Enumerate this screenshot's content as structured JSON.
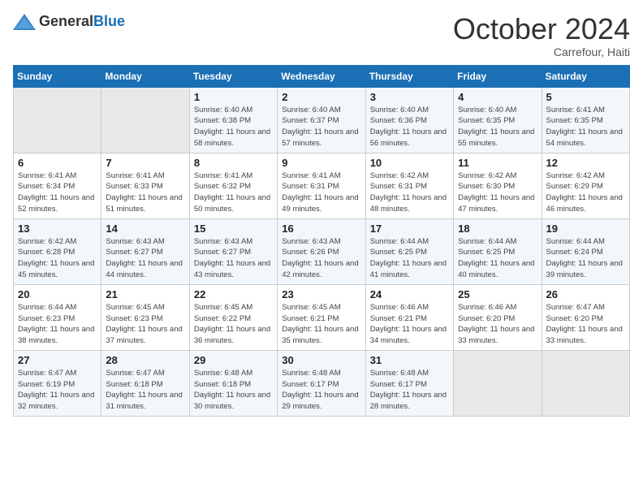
{
  "header": {
    "logo_general": "General",
    "logo_blue": "Blue",
    "title": "October 2024",
    "subtitle": "Carrefour, Haiti"
  },
  "days_of_week": [
    "Sunday",
    "Monday",
    "Tuesday",
    "Wednesday",
    "Thursday",
    "Friday",
    "Saturday"
  ],
  "weeks": [
    [
      {
        "day": "",
        "info": ""
      },
      {
        "day": "",
        "info": ""
      },
      {
        "day": "1",
        "info": "Sunrise: 6:40 AM\nSunset: 6:38 PM\nDaylight: 11 hours and 58 minutes."
      },
      {
        "day": "2",
        "info": "Sunrise: 6:40 AM\nSunset: 6:37 PM\nDaylight: 11 hours and 57 minutes."
      },
      {
        "day": "3",
        "info": "Sunrise: 6:40 AM\nSunset: 6:36 PM\nDaylight: 11 hours and 56 minutes."
      },
      {
        "day": "4",
        "info": "Sunrise: 6:40 AM\nSunset: 6:35 PM\nDaylight: 11 hours and 55 minutes."
      },
      {
        "day": "5",
        "info": "Sunrise: 6:41 AM\nSunset: 6:35 PM\nDaylight: 11 hours and 54 minutes."
      }
    ],
    [
      {
        "day": "6",
        "info": "Sunrise: 6:41 AM\nSunset: 6:34 PM\nDaylight: 11 hours and 52 minutes."
      },
      {
        "day": "7",
        "info": "Sunrise: 6:41 AM\nSunset: 6:33 PM\nDaylight: 11 hours and 51 minutes."
      },
      {
        "day": "8",
        "info": "Sunrise: 6:41 AM\nSunset: 6:32 PM\nDaylight: 11 hours and 50 minutes."
      },
      {
        "day": "9",
        "info": "Sunrise: 6:41 AM\nSunset: 6:31 PM\nDaylight: 11 hours and 49 minutes."
      },
      {
        "day": "10",
        "info": "Sunrise: 6:42 AM\nSunset: 6:31 PM\nDaylight: 11 hours and 48 minutes."
      },
      {
        "day": "11",
        "info": "Sunrise: 6:42 AM\nSunset: 6:30 PM\nDaylight: 11 hours and 47 minutes."
      },
      {
        "day": "12",
        "info": "Sunrise: 6:42 AM\nSunset: 6:29 PM\nDaylight: 11 hours and 46 minutes."
      }
    ],
    [
      {
        "day": "13",
        "info": "Sunrise: 6:42 AM\nSunset: 6:28 PM\nDaylight: 11 hours and 45 minutes."
      },
      {
        "day": "14",
        "info": "Sunrise: 6:43 AM\nSunset: 6:27 PM\nDaylight: 11 hours and 44 minutes."
      },
      {
        "day": "15",
        "info": "Sunrise: 6:43 AM\nSunset: 6:27 PM\nDaylight: 11 hours and 43 minutes."
      },
      {
        "day": "16",
        "info": "Sunrise: 6:43 AM\nSunset: 6:26 PM\nDaylight: 11 hours and 42 minutes."
      },
      {
        "day": "17",
        "info": "Sunrise: 6:44 AM\nSunset: 6:25 PM\nDaylight: 11 hours and 41 minutes."
      },
      {
        "day": "18",
        "info": "Sunrise: 6:44 AM\nSunset: 6:25 PM\nDaylight: 11 hours and 40 minutes."
      },
      {
        "day": "19",
        "info": "Sunrise: 6:44 AM\nSunset: 6:24 PM\nDaylight: 11 hours and 39 minutes."
      }
    ],
    [
      {
        "day": "20",
        "info": "Sunrise: 6:44 AM\nSunset: 6:23 PM\nDaylight: 11 hours and 38 minutes."
      },
      {
        "day": "21",
        "info": "Sunrise: 6:45 AM\nSunset: 6:23 PM\nDaylight: 11 hours and 37 minutes."
      },
      {
        "day": "22",
        "info": "Sunrise: 6:45 AM\nSunset: 6:22 PM\nDaylight: 11 hours and 36 minutes."
      },
      {
        "day": "23",
        "info": "Sunrise: 6:45 AM\nSunset: 6:21 PM\nDaylight: 11 hours and 35 minutes."
      },
      {
        "day": "24",
        "info": "Sunrise: 6:46 AM\nSunset: 6:21 PM\nDaylight: 11 hours and 34 minutes."
      },
      {
        "day": "25",
        "info": "Sunrise: 6:46 AM\nSunset: 6:20 PM\nDaylight: 11 hours and 33 minutes."
      },
      {
        "day": "26",
        "info": "Sunrise: 6:47 AM\nSunset: 6:20 PM\nDaylight: 11 hours and 33 minutes."
      }
    ],
    [
      {
        "day": "27",
        "info": "Sunrise: 6:47 AM\nSunset: 6:19 PM\nDaylight: 11 hours and 32 minutes."
      },
      {
        "day": "28",
        "info": "Sunrise: 6:47 AM\nSunset: 6:18 PM\nDaylight: 11 hours and 31 minutes."
      },
      {
        "day": "29",
        "info": "Sunrise: 6:48 AM\nSunset: 6:18 PM\nDaylight: 11 hours and 30 minutes."
      },
      {
        "day": "30",
        "info": "Sunrise: 6:48 AM\nSunset: 6:17 PM\nDaylight: 11 hours and 29 minutes."
      },
      {
        "day": "31",
        "info": "Sunrise: 6:48 AM\nSunset: 6:17 PM\nDaylight: 11 hours and 28 minutes."
      },
      {
        "day": "",
        "info": ""
      },
      {
        "day": "",
        "info": ""
      }
    ]
  ]
}
